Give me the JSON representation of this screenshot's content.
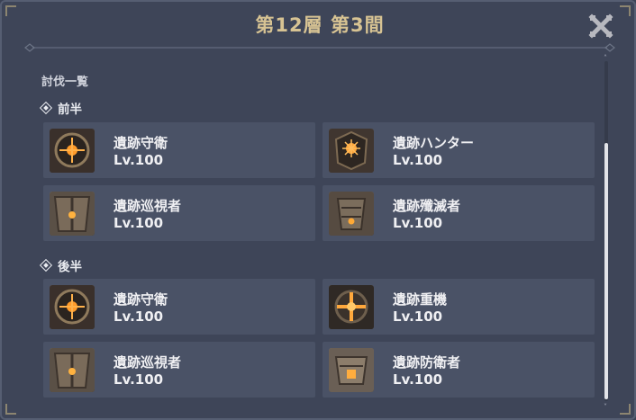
{
  "header": {
    "title": "第12層 第3間"
  },
  "section": {
    "heading": "討伐一覧"
  },
  "groups": [
    {
      "label": "前半",
      "enemies": [
        {
          "name": "遺跡守衛",
          "level": "Lv.100",
          "icon": "ruin-guard-icon"
        },
        {
          "name": "遺跡ハンター",
          "level": "Lv.100",
          "icon": "ruin-hunter-icon"
        },
        {
          "name": "遺跡巡視者",
          "level": "Lv.100",
          "icon": "ruin-cruiser-icon"
        },
        {
          "name": "遺跡殲滅者",
          "level": "Lv.100",
          "icon": "ruin-destroyer-icon"
        }
      ]
    },
    {
      "label": "後半",
      "enemies": [
        {
          "name": "遺跡守衛",
          "level": "Lv.100",
          "icon": "ruin-guard-icon"
        },
        {
          "name": "遺跡重機",
          "level": "Lv.100",
          "icon": "ruin-grader-icon"
        },
        {
          "name": "遺跡巡視者",
          "level": "Lv.100",
          "icon": "ruin-cruiser-icon"
        },
        {
          "name": "遺跡防衛者",
          "level": "Lv.100",
          "icon": "ruin-defender-icon"
        }
      ]
    }
  ],
  "colors": {
    "panel_bg": "#3e4558",
    "card_bg": "#4a5266",
    "title_gold": "#d7c393",
    "text_white": "#f0f0f3"
  }
}
